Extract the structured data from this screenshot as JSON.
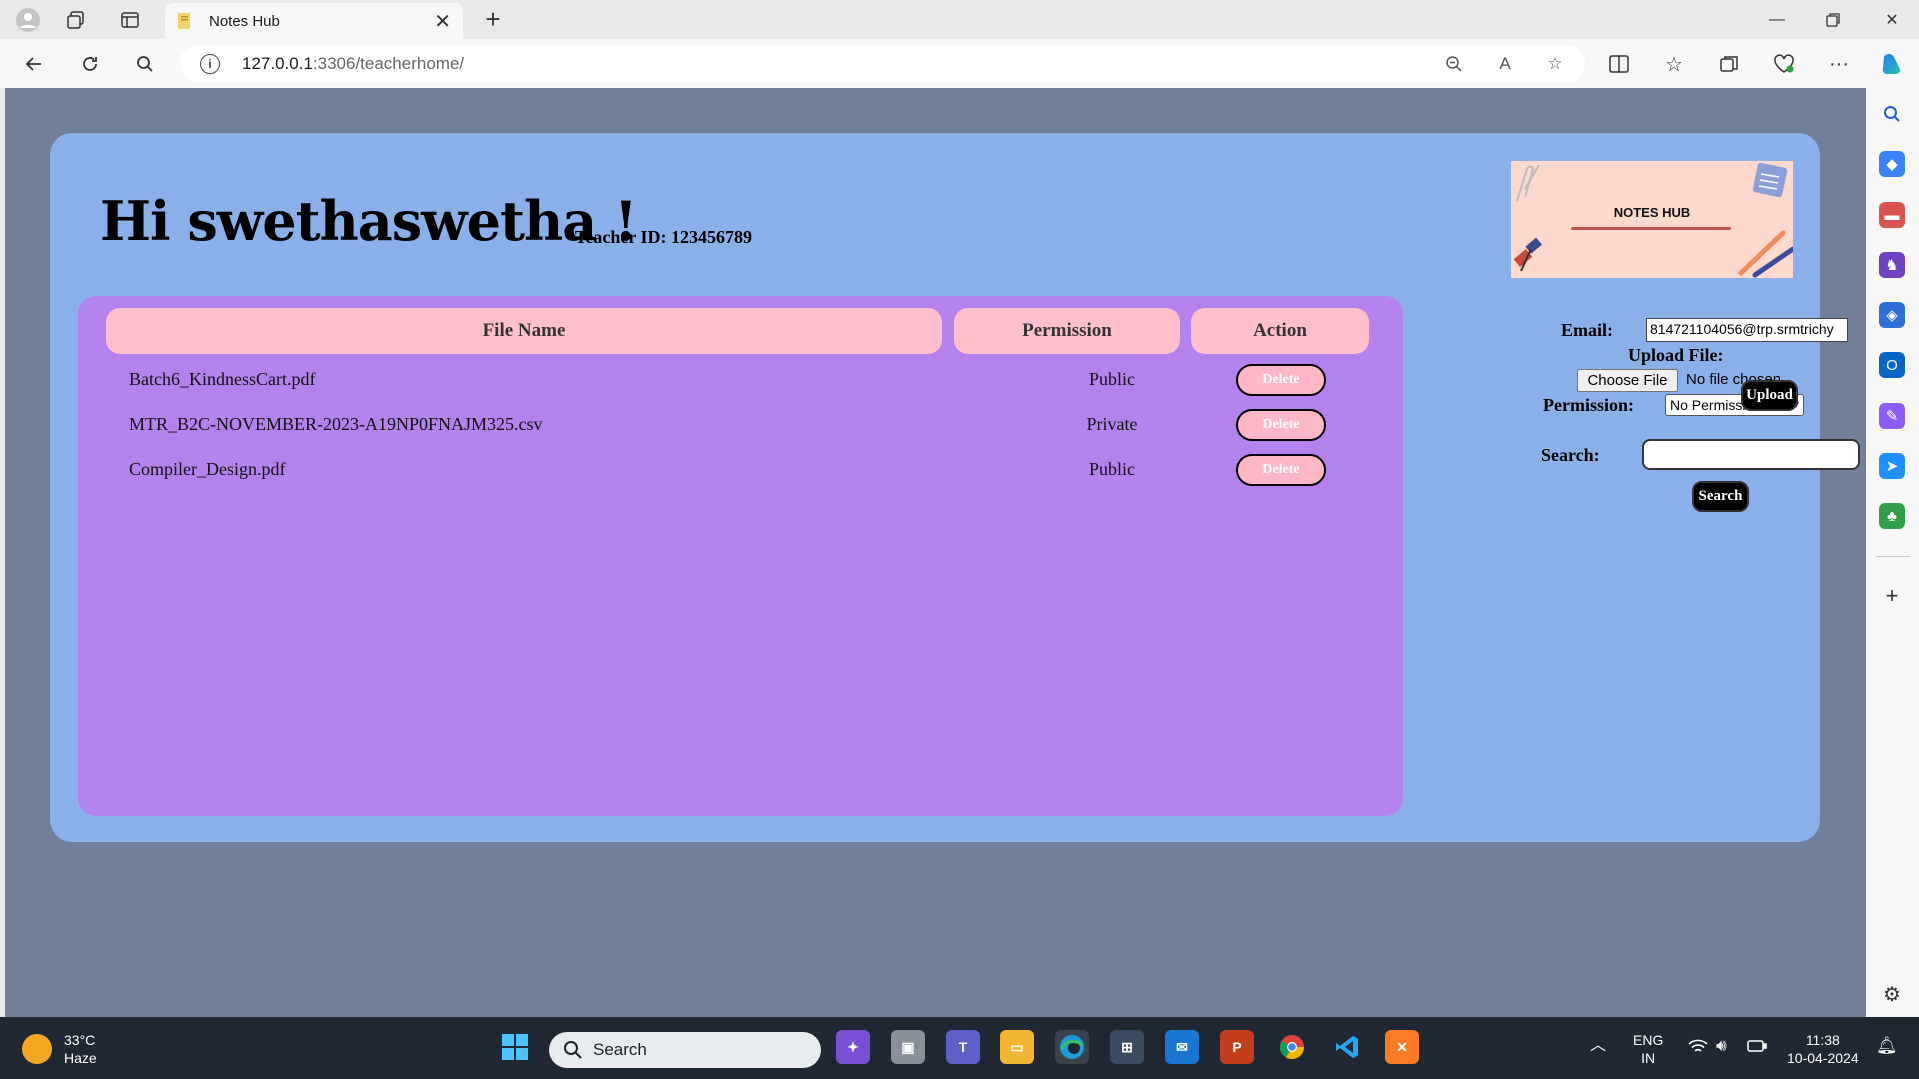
{
  "browser": {
    "tab_title": "Notes Hub",
    "url_host": "127.0.0.1",
    "url_path": ":3306/teacherhome/"
  },
  "page": {
    "greeting": "Hi swethaswetha !",
    "teacher_id": "Teacher ID: 123456789",
    "banner_text": "NOTES HUB",
    "table": {
      "columns": [
        "File Name",
        "Permission",
        "Action"
      ],
      "rows": [
        {
          "file": "Batch6_KindnessCart.pdf",
          "permission": "Public",
          "action": "Delete"
        },
        {
          "file": "MTR_B2C-NOVEMBER-2023-A19NP0FNAJM325.csv",
          "permission": "Private",
          "action": "Delete"
        },
        {
          "file": "Compiler_Design.pdf",
          "permission": "Public",
          "action": "Delete"
        }
      ]
    },
    "form": {
      "email_label": "Email:",
      "email_value": "814721104056@trp.srmtrichy",
      "upload_label": "Upload File:",
      "choose_file": "Choose File",
      "no_file": "No file chosen",
      "permission_label": "Permission:",
      "permission_value": "No Permission",
      "upload_button": "Upload",
      "search_label": "Search:",
      "search_value": "",
      "search_button": "Search"
    }
  },
  "taskbar": {
    "temperature": "33°C",
    "condition": "Haze",
    "search_placeholder": "Search",
    "lang": "ENG",
    "region": "IN",
    "time": "11:38",
    "date": "10-04-2024"
  }
}
